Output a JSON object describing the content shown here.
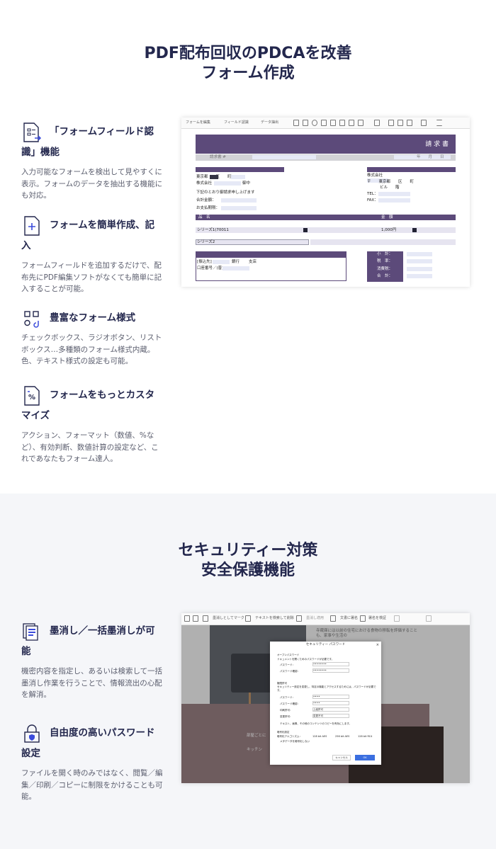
{
  "section1": {
    "title_line1": "PDF配布回収のPDCAを改善",
    "title_line2": "フォーム作成",
    "features": [
      {
        "icon": "form-recognition-icon",
        "title_a": "「フォームフィールド認",
        "title_b": "識」機能",
        "desc": "入力可能なフォームを検出して見やすくに表示。フォームのデータを抽出する機能にも対応。"
      },
      {
        "icon": "add-form-icon",
        "title_a": "フォームを簡単作成、記",
        "title_b": "入",
        "desc": "フォームフィールドを追加するだけで、配布先にPDF編集ソフトがなくても簡単に記入することが可能。"
      },
      {
        "icon": "form-styles-icon",
        "title_a": "豊富なフォーム様式",
        "title_b": "",
        "desc": "チェックボックス、ラジオボタン、リストボックス…多種類のフォーム様式内蔵。色、テキスト様式の設定も可能。"
      },
      {
        "icon": "percent-format-icon",
        "title_a": "フォームをもっとカスタ",
        "title_b": "マイズ",
        "desc": "アクション、フォーマット（数値、%など）、有効判断、数値計算の設定など、これであなたもフォーム達人。"
      }
    ],
    "screenshot": {
      "toolbar": [
        "フォームを編集",
        "フィールド認識",
        "データ抽出"
      ],
      "invoice_title": "請 求 書",
      "invoice_no": "請求書 #",
      "date_mark": "年　　月　　日",
      "address": "東京都　　区　　町",
      "company": "株式会社",
      "honorific": "御中",
      "note": "下記のとおり御請求申し上げます",
      "amount_label": "合計金額：",
      "due_label": "お支払期限：",
      "seller_company": "株式会社",
      "postal": "〒　　東京都　　区　　町",
      "building": "ビル　　階",
      "tel": "TEL：",
      "fax": "FAX：",
      "col_item": "品　名",
      "col_amount": "金　額",
      "row1_item": "シリーズ1(70011",
      "row1_amount": "1,000円",
      "row2_item": "シリーズ2",
      "bank_label": "[振込先]",
      "bank": "銀行",
      "branch": "支店",
      "account": "口座番号／(普)",
      "subtotal": "小　計：",
      "tax": "税　率：",
      "consumption": "消費税：",
      "total": "合　計："
    }
  },
  "section2": {
    "title_line1": "セキュリティー対策",
    "title_line2": "安全保護機能",
    "features": [
      {
        "icon": "redaction-icon",
        "title_a": "墨消し／一括墨消しが可",
        "title_b": "能",
        "desc": "機密内容を指定し、あるいは検索して一括墨消し作業を行うことで、情報流出の心配を解消。"
      },
      {
        "icon": "password-lock-icon",
        "title_a": "自由度の高いパスワード",
        "title_b": "設定",
        "desc": "ファイルを開く時のみではなく、閲覧／編集／印刷／コピーに制限をかけることも可能。"
      }
    ],
    "screenshot": {
      "toolbar": [
        "墨消しとしてマーク",
        "テキストを検索して削除",
        "墨消し適用",
        "文書に署名",
        "署名を検証"
      ],
      "dialog_title": "セキュリティー パスワード",
      "open_pw_section": "オープンパスワード",
      "open_pw_check": "ドキュメントを開くためのパスワードが必要です。",
      "pw_label": "パスワード：",
      "pw_confirm": "パスワード確認：",
      "pw_mask": "••••••••",
      "perm_section": "権限許可",
      "perm_check": "セキュリティー設定を変更し、特定の機能とアクセスするためには、パスワードが必要です。",
      "perm_pw": "••••",
      "print_label": "印刷許可：",
      "print_val": "上級許可",
      "edit_label": "変更許可：",
      "edit_val": "変更不可",
      "copy_check": "テキスト、画像、その他のコンテンツのコピーを有効にします。",
      "encrypt_section": "暗号化設定",
      "encrypt_label": "暗号化アルゴリズム：",
      "enc1": "128 bit AES",
      "enc2": "256 bit AES",
      "enc3": "128 bit RC4",
      "meta_check": "メタデータを暗号化しない",
      "cancel": "キャンセル",
      "ok": "OK",
      "bg_text1": "寺蔵庫には以前の住宅における食物の移転を評価することも、家事や生活の",
      "bg_text2": "部屋ごとに",
      "bg_text3": "キッチン"
    }
  },
  "colors": {
    "title": "#23274d",
    "accent": "#5c4a7a",
    "icon": "#3b4bdb"
  }
}
